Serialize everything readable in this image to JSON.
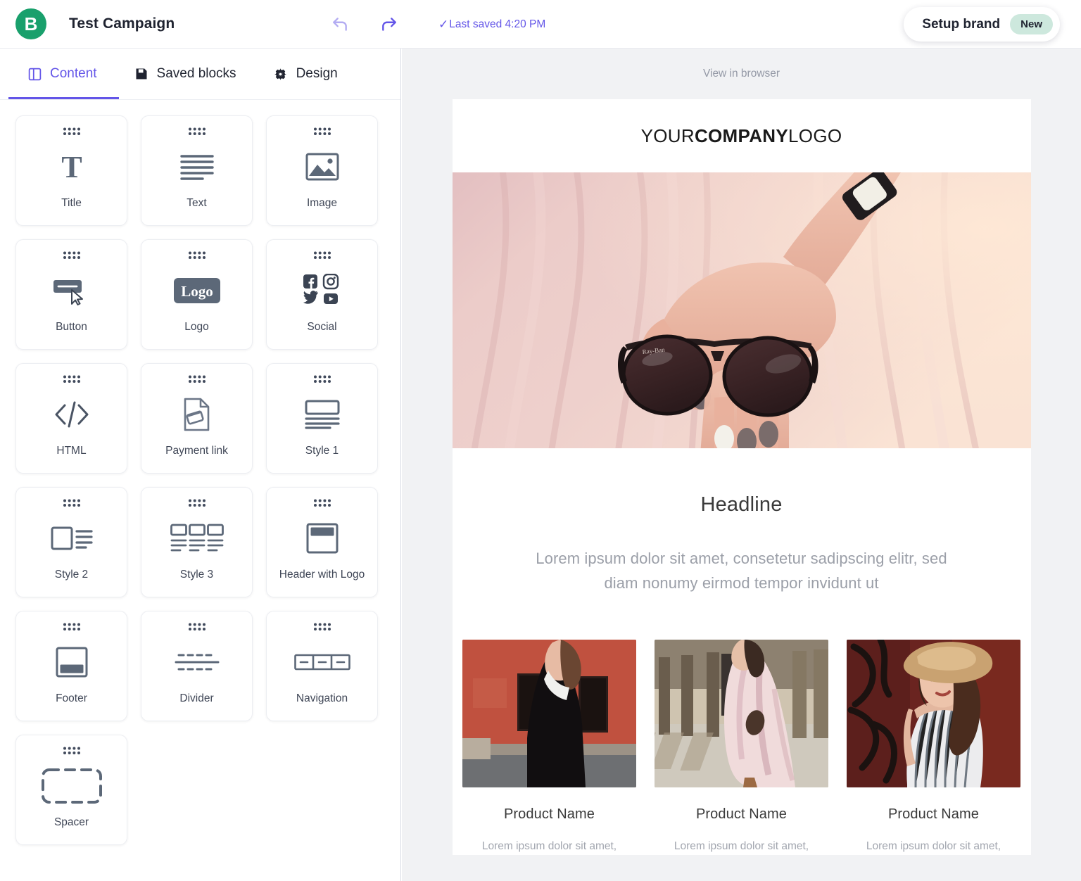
{
  "header": {
    "logo_letter": "B",
    "logo_color": "#19a06c",
    "campaign_title": "Test Campaign",
    "undo_icon": "undo-arrow-icon",
    "redo_icon": "redo-arrow-icon",
    "saved_check": "✓",
    "saved_text": "Last saved 4:20 PM",
    "saved_color": "#6355e8",
    "setup_brand_label": "Setup brand",
    "setup_brand_badge": "New",
    "badge_color": "#cde8dd"
  },
  "tabs": [
    {
      "label": "Content",
      "icon": "panel-layout-icon",
      "active": true
    },
    {
      "label": "Saved blocks",
      "icon": "floppy-disk-icon",
      "active": false
    },
    {
      "label": "Design",
      "icon": "gear-icon",
      "active": false
    }
  ],
  "accent_color": "#6355e8",
  "blocks": [
    {
      "label": "Title",
      "icon": "serif-t-icon"
    },
    {
      "label": "Text",
      "icon": "text-lines-icon"
    },
    {
      "label": "Image",
      "icon": "picture-icon"
    },
    {
      "label": "Button",
      "icon": "button-cursor-icon"
    },
    {
      "label": "Logo",
      "icon": "logo-chip-icon"
    },
    {
      "label": "Social",
      "icon": "social-networks-icon"
    },
    {
      "label": "HTML",
      "icon": "code-brackets-icon"
    },
    {
      "label": "Payment link",
      "icon": "document-card-icon"
    },
    {
      "label": "Style 1",
      "icon": "image-over-text-icon"
    },
    {
      "label": "Style 2",
      "icon": "image-beside-text-icon"
    },
    {
      "label": "Style 3",
      "icon": "three-column-icon"
    },
    {
      "label": "Header with Logo",
      "icon": "header-logo-icon"
    },
    {
      "label": "Footer",
      "icon": "footer-icon"
    },
    {
      "label": "Divider",
      "icon": "divider-icon"
    },
    {
      "label": "Navigation",
      "icon": "navigation-bar-icon"
    },
    {
      "label": "Spacer",
      "icon": "dashed-box-icon"
    }
  ],
  "preview": {
    "view_in_browser": "View in browser",
    "logo_part1": "YOUR",
    "logo_part2": "COMPANY",
    "logo_part3": "LOGO",
    "hero_alt": "hands-holding-sunglasses-pink-dress-image",
    "headline": "Headline",
    "body": "Lorem ipsum dolor sit amet, consetetur sadipscing elitr, sed diam nonumy eirmod tempor invidunt ut",
    "products": [
      {
        "name": "Product Name",
        "desc": "Lorem ipsum dolor sit amet,",
        "image": "woman-black-dress-red-wall-image"
      },
      {
        "name": "Product Name",
        "desc": "Lorem ipsum dolor sit amet,",
        "image": "woman-floral-dress-colonnade-image"
      },
      {
        "name": "Product Name",
        "desc": "Lorem ipsum dolor sit amet,",
        "image": "woman-hat-striped-top-image"
      }
    ]
  }
}
